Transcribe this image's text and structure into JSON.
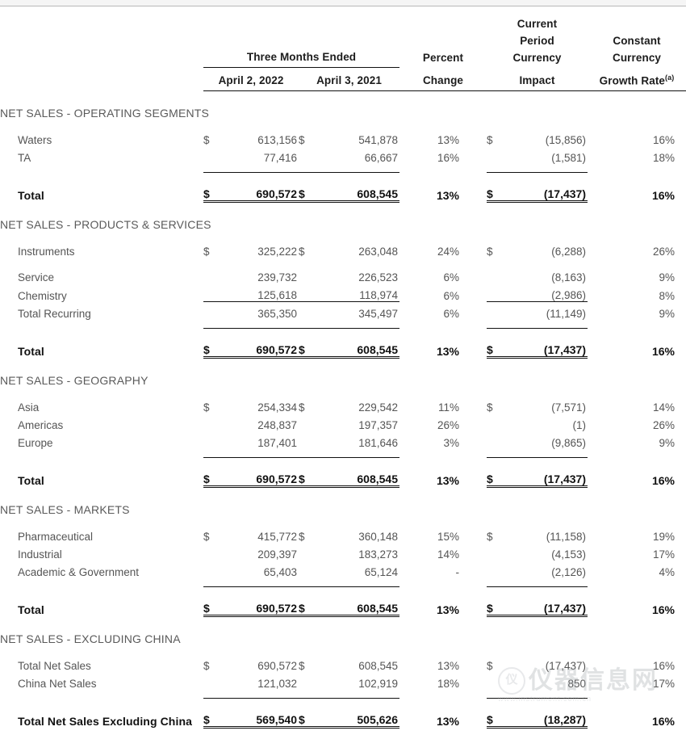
{
  "header": {
    "group_label": "Three Months Ended",
    "columns": [
      "April 2, 2022",
      "April 3, 2021"
    ],
    "percent_change": {
      "line1": "Percent",
      "line2": "Change"
    },
    "currency_impact": {
      "line1": "Current",
      "line2": "Period",
      "line3": "Currency",
      "line4": "Impact"
    },
    "growth_rate": {
      "line1": "Constant",
      "line2": "Currency",
      "line3": "Growth Rate",
      "footnote": "(a)"
    },
    "currency_symbol": "$"
  },
  "watermark": {
    "logo": "仪",
    "main": "仪器信息网",
    "sub": "www.instrument.com.cn"
  },
  "sections": [
    {
      "title": "NET SALES - OPERATING SEGMENTS",
      "rows": [
        {
          "label": "Waters",
          "cur1": "$",
          "v1": "613,156",
          "cur2": "$",
          "v2": "541,878",
          "pct": "13%",
          "cur3": "$",
          "imp": "(15,856)",
          "grw": "16%"
        },
        {
          "label": "TA",
          "cur1": "",
          "v1": "77,416",
          "cur2": "",
          "v2": "66,667",
          "pct": "16%",
          "cur3": "",
          "imp": "(1,581)",
          "grw": "18%"
        }
      ],
      "total": {
        "label": "Total",
        "cur1": "$",
        "v1": "690,572",
        "cur2": "$",
        "v2": "608,545",
        "pct": "13%",
        "cur3": "$",
        "imp": "(17,437)",
        "grw": "16%"
      }
    },
    {
      "title": "NET SALES - PRODUCTS & SERVICES",
      "rows": [
        {
          "label": "Instruments",
          "cur1": "$",
          "v1": "325,222",
          "cur2": "$",
          "v2": "263,048",
          "pct": "24%",
          "cur3": "$",
          "imp": "(6,288)",
          "grw": "26%",
          "gap_after": true
        },
        {
          "label": "Service",
          "cur1": "",
          "v1": "239,732",
          "cur2": "",
          "v2": "226,523",
          "pct": "6%",
          "cur3": "",
          "imp": "(8,163)",
          "grw": "9%"
        },
        {
          "label": "Chemistry",
          "cur1": "",
          "v1": "125,618",
          "cur2": "",
          "v2": "118,974",
          "pct": "6%",
          "cur3": "",
          "imp": "(2,986)",
          "grw": "8%"
        },
        {
          "label": "Total Recurring",
          "cur1": "",
          "v1": "365,350",
          "cur2": "",
          "v2": "345,497",
          "pct": "6%",
          "cur3": "",
          "imp": "(11,149)",
          "grw": "9%",
          "subtotal_rule": true
        }
      ],
      "total": {
        "label": "Total",
        "cur1": "$",
        "v1": "690,572",
        "cur2": "$",
        "v2": "608,545",
        "pct": "13%",
        "cur3": "$",
        "imp": "(17,437)",
        "grw": "16%"
      }
    },
    {
      "title": "NET SALES - GEOGRAPHY",
      "rows": [
        {
          "label": "Asia",
          "cur1": "$",
          "v1": "254,334",
          "cur2": "$",
          "v2": "229,542",
          "pct": "11%",
          "cur3": "$",
          "imp": "(7,571)",
          "grw": "14%"
        },
        {
          "label": "Americas",
          "cur1": "",
          "v1": "248,837",
          "cur2": "",
          "v2": "197,357",
          "pct": "26%",
          "cur3": "",
          "imp": "(1)",
          "grw": "26%"
        },
        {
          "label": "Europe",
          "cur1": "",
          "v1": "187,401",
          "cur2": "",
          "v2": "181,646",
          "pct": "3%",
          "cur3": "",
          "imp": "(9,865)",
          "grw": "9%"
        }
      ],
      "total": {
        "label": "Total",
        "cur1": "$",
        "v1": "690,572",
        "cur2": "$",
        "v2": "608,545",
        "pct": "13%",
        "cur3": "$",
        "imp": "(17,437)",
        "grw": "16%"
      }
    },
    {
      "title": "NET SALES - MARKETS",
      "rows": [
        {
          "label": "Pharmaceutical",
          "cur1": "$",
          "v1": "415,772",
          "cur2": "$",
          "v2": "360,148",
          "pct": "15%",
          "cur3": "$",
          "imp": "(11,158)",
          "grw": "19%"
        },
        {
          "label": "Industrial",
          "cur1": "",
          "v1": "209,397",
          "cur2": "",
          "v2": "183,273",
          "pct": "14%",
          "cur3": "",
          "imp": "(4,153)",
          "grw": "17%"
        },
        {
          "label": "Academic & Government",
          "cur1": "",
          "v1": "65,403",
          "cur2": "",
          "v2": "65,124",
          "pct": "-",
          "cur3": "",
          "imp": "(2,126)",
          "grw": "4%"
        }
      ],
      "total": {
        "label": "Total",
        "cur1": "$",
        "v1": "690,572",
        "cur2": "$",
        "v2": "608,545",
        "pct": "13%",
        "cur3": "$",
        "imp": "(17,437)",
        "grw": "16%"
      }
    },
    {
      "title": "NET SALES - EXCLUDING CHINA",
      "rows": [
        {
          "label": "Total Net Sales",
          "cur1": "$",
          "v1": "690,572",
          "cur2": "$",
          "v2": "608,545",
          "pct": "13%",
          "cur3": "$",
          "imp": "(17,437)",
          "grw": "16%"
        },
        {
          "label": "China Net Sales",
          "cur1": "",
          "v1": "121,032",
          "cur2": "",
          "v2": "102,919",
          "pct": "18%",
          "cur3": "",
          "imp": "850",
          "grw": "17%"
        }
      ],
      "total": {
        "label": "Total Net Sales Excluding China",
        "cur1": "$",
        "v1": "569,540",
        "cur2": "$",
        "v2": "505,626",
        "pct": "13%",
        "cur3": "$",
        "imp": "(18,287)",
        "grw": "16%"
      }
    }
  ]
}
